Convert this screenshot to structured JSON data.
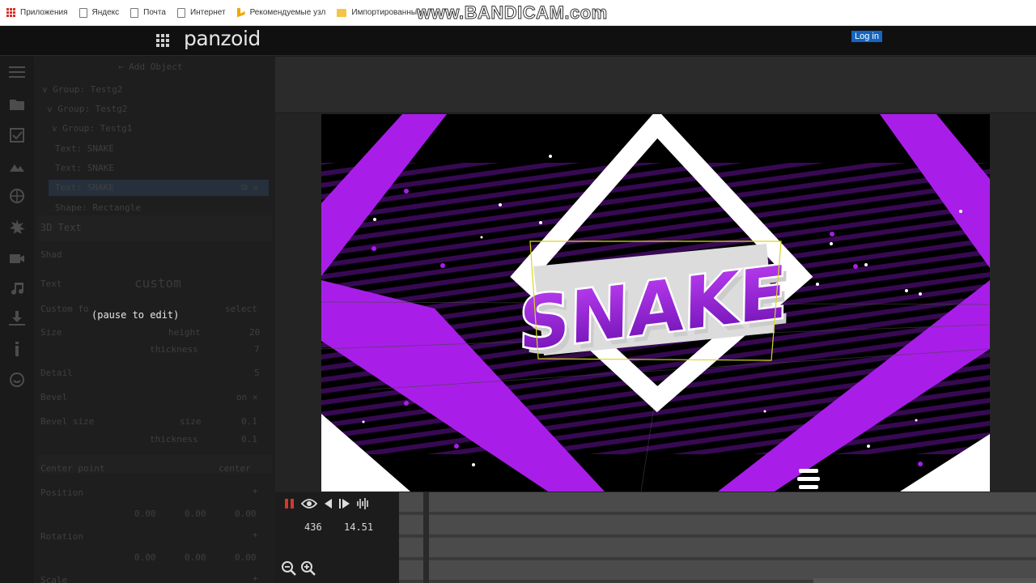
{
  "browser": {
    "bookmarks": [
      {
        "label": "Приложения",
        "icon": "apps-grid-icon"
      },
      {
        "label": "Яндекс",
        "icon": "page-icon"
      },
      {
        "label": "Почта",
        "icon": "page-icon"
      },
      {
        "label": "Интернет",
        "icon": "page-icon"
      },
      {
        "label": "Рекомендуемые узл",
        "icon": "bing-icon"
      },
      {
        "label": "Импортированные",
        "icon": "folder-icon"
      }
    ],
    "watermark": "www.BANDICAM.com"
  },
  "header": {
    "logo": "panzoid",
    "login_label": "Log in"
  },
  "panel": {
    "add_object": "Add Object",
    "tree": [
      "Group: Testg2",
      "Group: Testg2",
      "Group: Testg1",
      "Text: SNAKE",
      "Text: SNAKE",
      "Text: SNAKE",
      "Shape: Rectangle"
    ],
    "section_title": "3D Text",
    "sub_label": "Shad",
    "text_label": "Text",
    "text_value": "custom",
    "custom_font_label": "Custom fo",
    "custom_font_value": "select",
    "size_label": "Size",
    "height_label": "height",
    "height_value": "20",
    "thickness_label": "thickness",
    "thickness_value": "7",
    "detail_label": "Detail",
    "detail_value": "5",
    "bevel_label": "Bevel",
    "bevel_value": "on",
    "bevel_size_label": "Bevel size",
    "bevel_size_sub": "size",
    "bevel_size_value": "0.1",
    "bevel_thickness_label": "thickness",
    "bevel_thickness_value": "0.1",
    "center_label": "Center point",
    "center_value": "center",
    "position_label": "Position",
    "position_values": [
      "0.00",
      "0.00",
      "0.00"
    ],
    "rotation_label": "Rotation",
    "rotation_values": [
      "0.00",
      "0.00",
      "0.00"
    ],
    "scale_label": "Scale",
    "overlay": "(pause to edit)"
  },
  "preview": {
    "title_text": "SNAKE",
    "colors": {
      "purple": "#a81ee8",
      "white": "#ffffff",
      "bg": "#000000"
    }
  },
  "timeline": {
    "frame": "436",
    "time": "14.51",
    "controls": [
      "pause-icon",
      "eye-icon",
      "previous-icon",
      "play-next-icon",
      "waveform-icon"
    ]
  }
}
